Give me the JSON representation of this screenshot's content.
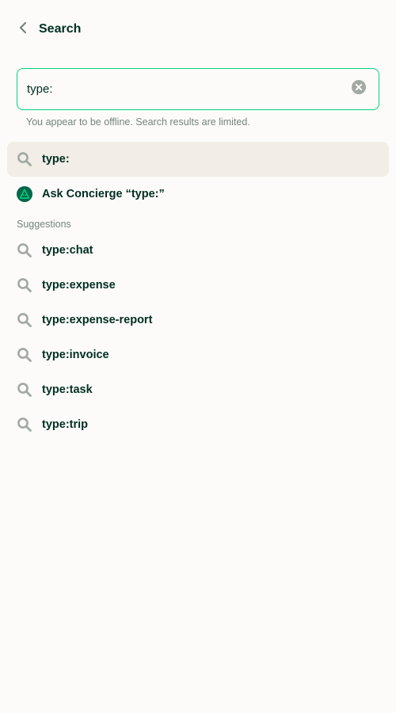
{
  "header": {
    "title": "Search",
    "back_icon": "chevron-left-icon"
  },
  "search": {
    "value": "type:",
    "clear_icon": "clear-circle-icon",
    "accent_color": "#03D47C"
  },
  "offline_note": "You appear to be offline. Search results are limited.",
  "current_query": {
    "label": "type:",
    "icon": "search-icon"
  },
  "concierge": {
    "label": "Ask Concierge “type:”",
    "icon": "concierge-avatar-icon"
  },
  "suggestions": {
    "title": "Suggestions",
    "items": [
      {
        "label": "type:chat",
        "icon": "search-icon"
      },
      {
        "label": "type:expense",
        "icon": "search-icon"
      },
      {
        "label": "type:expense-report",
        "icon": "search-icon"
      },
      {
        "label": "type:invoice",
        "icon": "search-icon"
      },
      {
        "label": "type:task",
        "icon": "search-icon"
      },
      {
        "label": "type:trip",
        "icon": "search-icon"
      }
    ]
  }
}
